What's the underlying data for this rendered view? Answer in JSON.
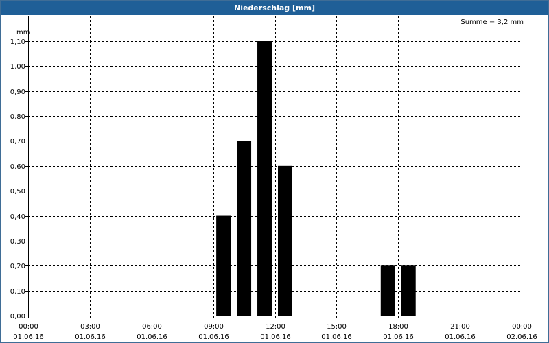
{
  "window": {
    "title": "Niederschlag [mm]"
  },
  "summary": "Summe = 3,2 mm",
  "chart_data": {
    "type": "bar",
    "title": "Niederschlag [mm]",
    "ylabel": "mm",
    "ylim": [
      0,
      1.1
    ],
    "yticks": [
      "0,00",
      "0,10",
      "0,20",
      "0,30",
      "0,40",
      "0,50",
      "0,60",
      "0,70",
      "0,80",
      "0,90",
      "1,00",
      "1,10"
    ],
    "xlim_hours": [
      0,
      24
    ],
    "xticks": [
      {
        "time": "00:00",
        "date": "01.06.16"
      },
      {
        "time": "03:00",
        "date": "01.06.16"
      },
      {
        "time": "06:00",
        "date": "01.06.16"
      },
      {
        "time": "09:00",
        "date": "01.06.16"
      },
      {
        "time": "12:00",
        "date": "01.06.16"
      },
      {
        "time": "15:00",
        "date": "01.06.16"
      },
      {
        "time": "18:00",
        "date": "01.06.16"
      },
      {
        "time": "21:00",
        "date": "01.06.16"
      },
      {
        "time": "00:00",
        "date": "02.06.16"
      }
    ],
    "bars": [
      {
        "start": "09:00",
        "end": "10:00",
        "value": 0.4
      },
      {
        "start": "10:00",
        "end": "11:00",
        "value": 0.7
      },
      {
        "start": "11:00",
        "end": "12:00",
        "value": 1.1
      },
      {
        "start": "12:00",
        "end": "13:00",
        "value": 0.6
      },
      {
        "start": "17:00",
        "end": "18:00",
        "value": 0.2
      },
      {
        "start": "18:00",
        "end": "19:00",
        "value": 0.2
      }
    ],
    "grid": true,
    "bar_color": "#000000"
  }
}
